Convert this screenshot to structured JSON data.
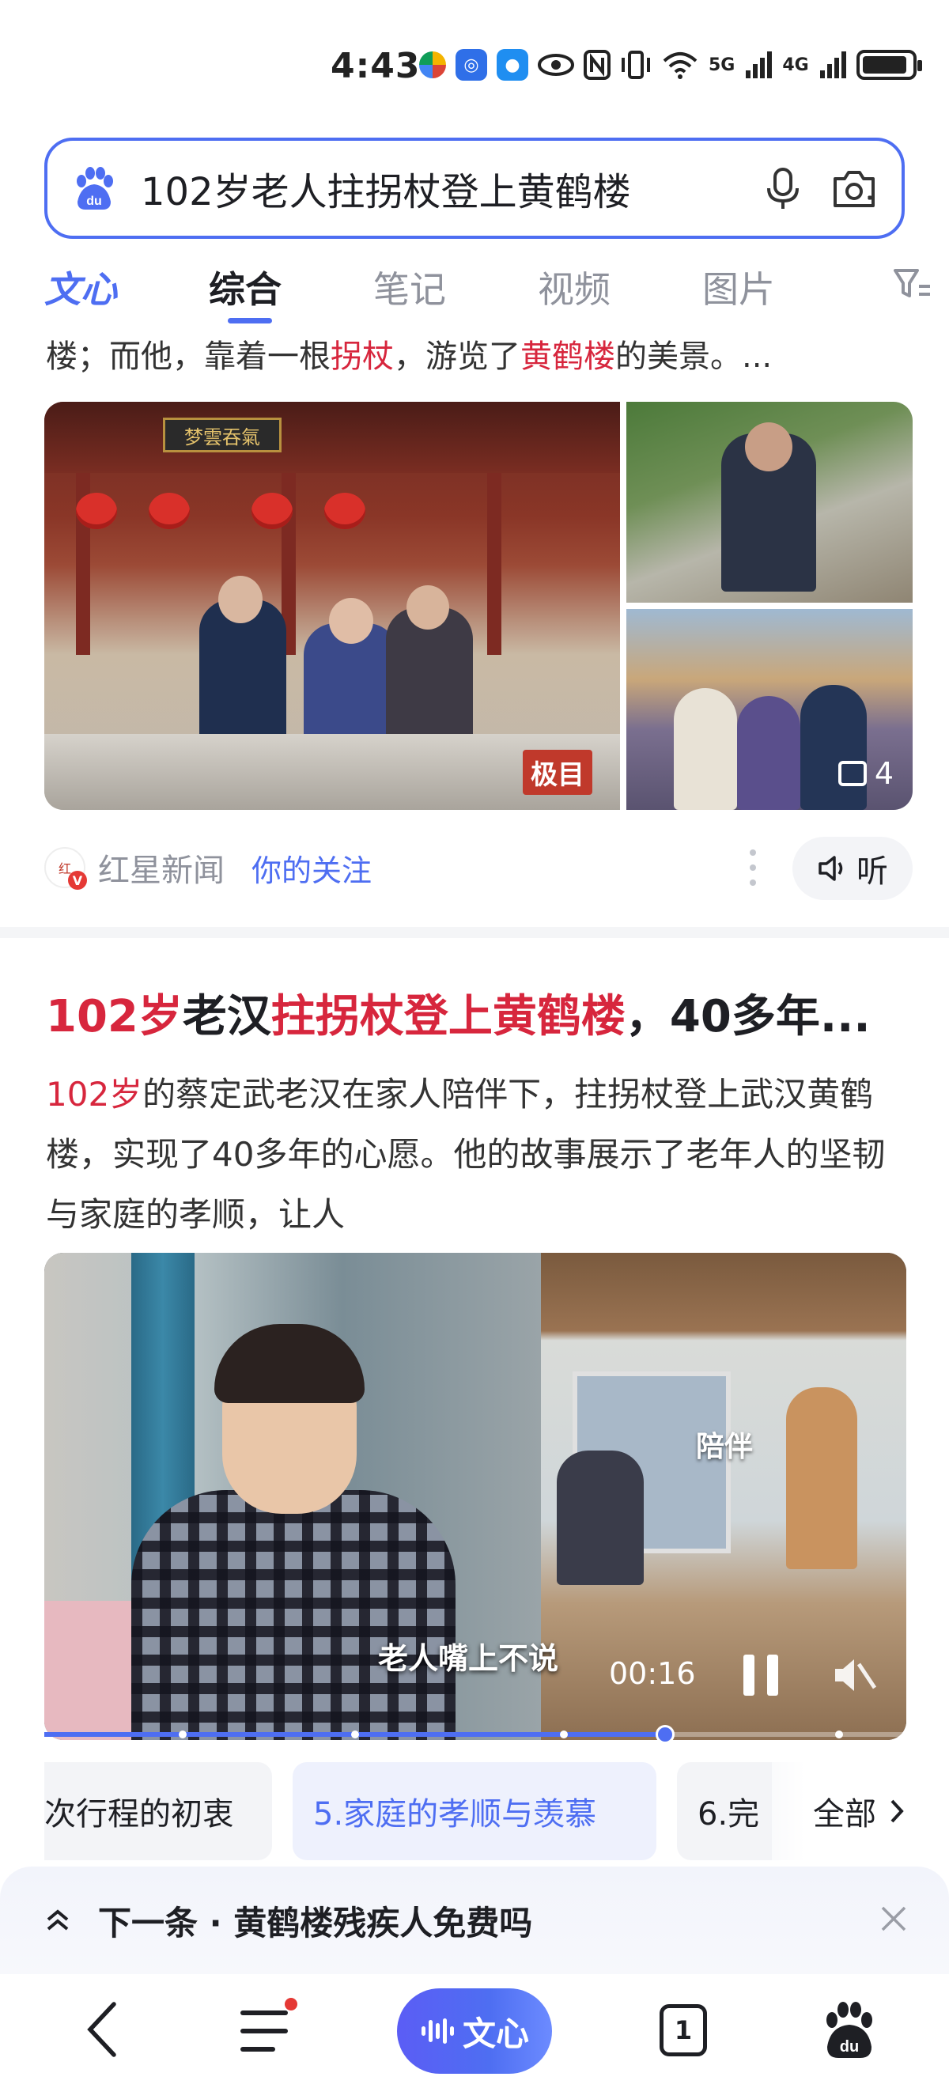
{
  "status_bar": {
    "time": "4:43",
    "network_5g": "5G",
    "network_4g": "4G",
    "icons": [
      "app-icon",
      "app-icon",
      "app-icon",
      "eye-icon",
      "nfc-icon",
      "vibrate-icon",
      "wifi-icon",
      "signal-icon",
      "signal-icon",
      "battery-icon"
    ]
  },
  "search": {
    "query": "102岁老人拄拐杖登上黄鹤楼",
    "logo_text": "du"
  },
  "tabs": [
    {
      "label": "文心"
    },
    {
      "label": "综合"
    },
    {
      "label": "笔记"
    },
    {
      "label": "视频"
    },
    {
      "label": "图片"
    }
  ],
  "result1": {
    "snippet_parts": [
      "楼；而他，靠着一根",
      "拐杖",
      "，游览了",
      "黄鹤楼",
      "的美景。..."
    ],
    "photo_plaque": "梦雲吞氣",
    "watermark": "极目",
    "image_count": "4",
    "source_name": "红星新闻",
    "follow_label": "你的关注",
    "listen_label": "听"
  },
  "result2": {
    "title_parts": [
      "102岁",
      "老汉",
      "拄拐杖登上黄鹤楼",
      "，40多年..."
    ],
    "desc_hl": "102岁",
    "desc_rest": "的蔡定武老汉在家人陪伴下，拄拐杖登上武汉黄鹤楼，实现了40多年的心愿。他的故事展示了老年人的坚韧与家庭的孝顺，让人",
    "video": {
      "caption_right": "陪伴",
      "subtitle": "老人嘴上不说",
      "time": "00:16",
      "progress": 0.72
    },
    "chapters": [
      {
        "label": "次行程的初衷",
        "active": false
      },
      {
        "label": "5.家庭的孝顺与羡慕",
        "active": true
      },
      {
        "label": "6.完",
        "active": false
      }
    ],
    "all_label": "全部"
  },
  "next_bar": {
    "text": "下一条 · 黄鹤楼残疾人免费吗"
  },
  "bottom_nav": {
    "wenxin_label": "文心",
    "tab_count": "1"
  },
  "colors": {
    "accent": "#4e6ef2",
    "highlight": "#d7263d",
    "muted": "#8f929c"
  }
}
